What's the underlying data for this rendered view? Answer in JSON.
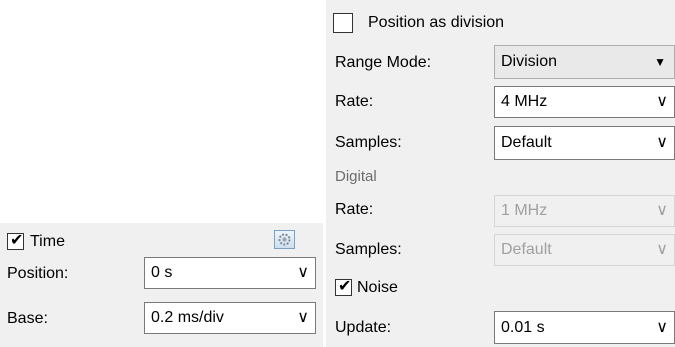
{
  "left": {
    "time_label": "Time",
    "time_checked": true,
    "position_label": "Position:",
    "position_value": "0 s",
    "base_label": "Base:",
    "base_value": "0.2 ms/div",
    "gear_icon": "gear-icon"
  },
  "right": {
    "position_as_division_label": "Position as division",
    "position_as_division_checked": false,
    "range_mode_label": "Range Mode:",
    "range_mode_value": "Division",
    "rate_label": "Rate:",
    "rate_value": "4 MHz",
    "samples_label": "Samples:",
    "samples_value": "Default",
    "digital_header": "Digital",
    "digital_rate_label": "Rate:",
    "digital_rate_value": "1 MHz",
    "digital_samples_label": "Samples:",
    "digital_samples_value": "Default",
    "noise_label": "Noise",
    "noise_checked": true,
    "update_label": "Update:",
    "update_value": "0.01 s"
  },
  "icons": {
    "dropdown_arrow": "∨",
    "dropdown_triangle": "▼",
    "check": "✔"
  }
}
